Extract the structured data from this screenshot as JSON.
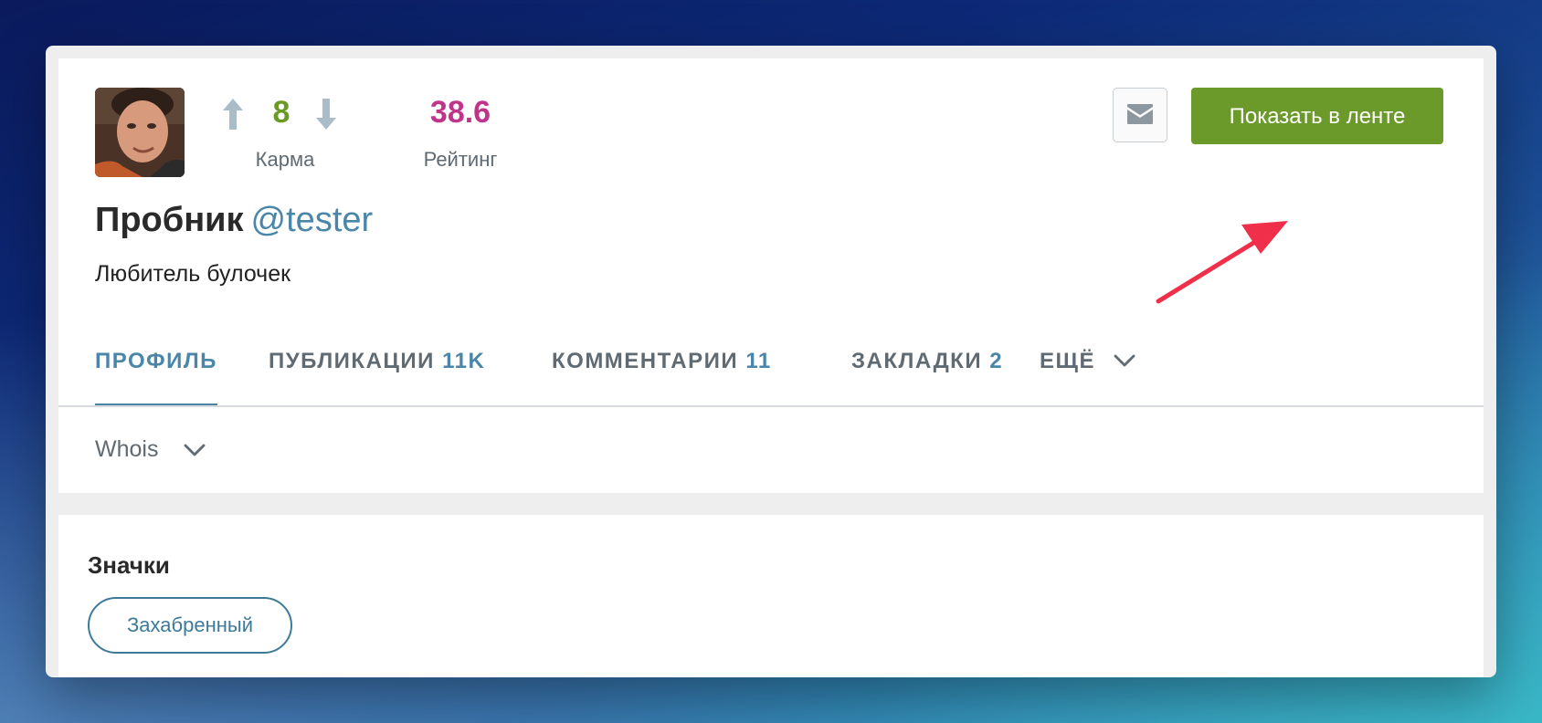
{
  "profile": {
    "avatar_alt": "avatar",
    "karma": {
      "value": "8",
      "label": "Карма"
    },
    "rating": {
      "value": "38.6",
      "label": "Рейтинг"
    },
    "name": "Пробник",
    "nickname": "@tester",
    "bio": "Любитель булочек"
  },
  "actions": {
    "mail_icon": "mail-icon",
    "show_in_feed_label": "Показать в ленте"
  },
  "tabs": [
    {
      "label": "ПРОФИЛЬ",
      "count": ""
    },
    {
      "label": "ПУБЛИКАЦИИ",
      "count": "11K"
    },
    {
      "label": "КОММЕНТАРИИ",
      "count": "11"
    },
    {
      "label": "ЗАКЛАДКИ",
      "count": "2"
    },
    {
      "label": "ЕЩЁ",
      "count": ""
    }
  ],
  "whois": {
    "label": "Whois"
  },
  "badges": {
    "title": "Значки",
    "items": [
      {
        "label": "Захабренный"
      }
    ]
  },
  "colors": {
    "accent_blue": "#4a86a8",
    "karma_green": "#6a9a23",
    "rating_magenta": "#c0348a",
    "feed_button_green": "#6c9a2a",
    "annotation_arrow_red": "#f0304a"
  }
}
